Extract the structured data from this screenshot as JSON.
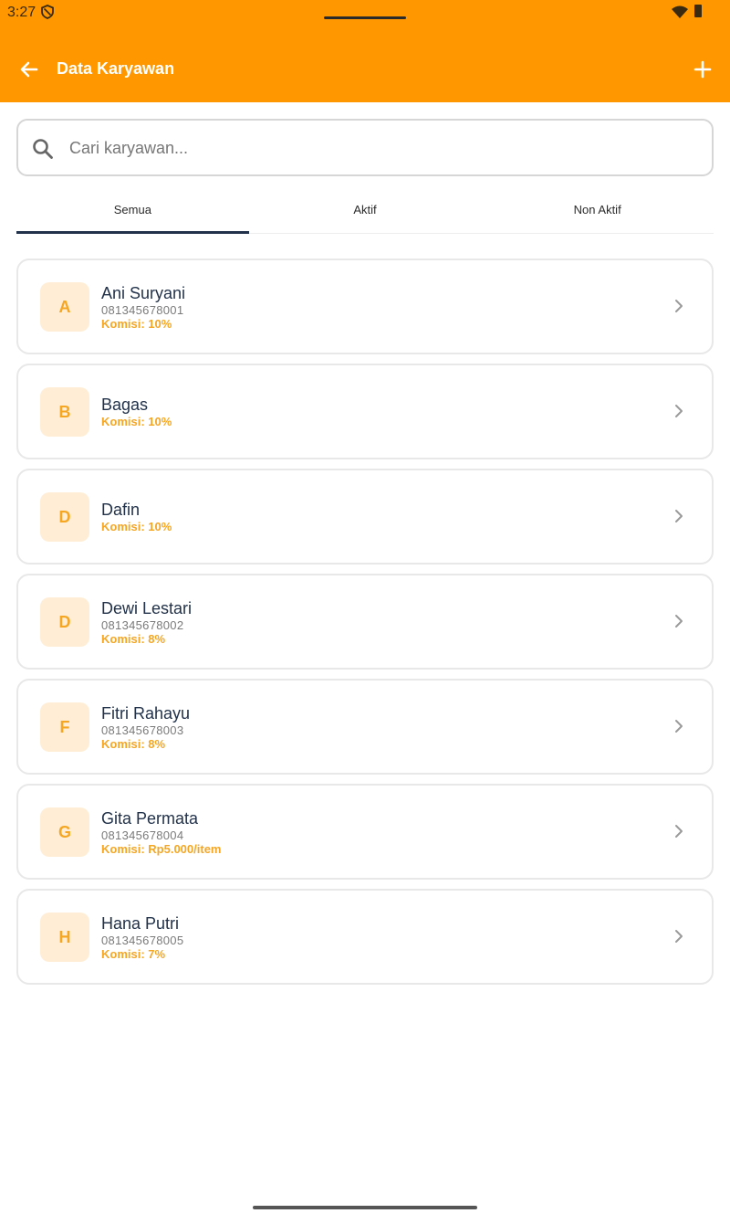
{
  "status": {
    "time": "3:27"
  },
  "header": {
    "title": "Data Karyawan"
  },
  "search": {
    "placeholder": "Cari karyawan..."
  },
  "tabs": [
    {
      "label": "Semua",
      "active": true
    },
    {
      "label": "Aktif",
      "active": false
    },
    {
      "label": "Non Aktif",
      "active": false
    }
  ],
  "employees": [
    {
      "initial": "A",
      "name": "Ani Suryani",
      "phone": "081345678001",
      "commission": "Komisi: 10%"
    },
    {
      "initial": "B",
      "name": "Bagas",
      "phone": "",
      "commission": "Komisi: 10%"
    },
    {
      "initial": "D",
      "name": "Dafin",
      "phone": "",
      "commission": "Komisi: 10%"
    },
    {
      "initial": "D",
      "name": "Dewi Lestari",
      "phone": "081345678002",
      "commission": "Komisi: 8%"
    },
    {
      "initial": "F",
      "name": "Fitri Rahayu",
      "phone": "081345678003",
      "commission": "Komisi: 8%"
    },
    {
      "initial": "G",
      "name": "Gita Permata",
      "phone": "081345678004",
      "commission": "Komisi: Rp5.000/item"
    },
    {
      "initial": "H",
      "name": "Hana Putri",
      "phone": "081345678005",
      "commission": "Komisi: 7%"
    }
  ],
  "colors": {
    "primary": "#FF9800",
    "accent_text": "#F5A623",
    "avatar_bg": "#FFEED5",
    "name_text": "#22324a"
  },
  "icons": {
    "back": "arrow-left-icon",
    "add": "plus-icon",
    "search": "search-icon",
    "row": "chevron-right-icon"
  }
}
